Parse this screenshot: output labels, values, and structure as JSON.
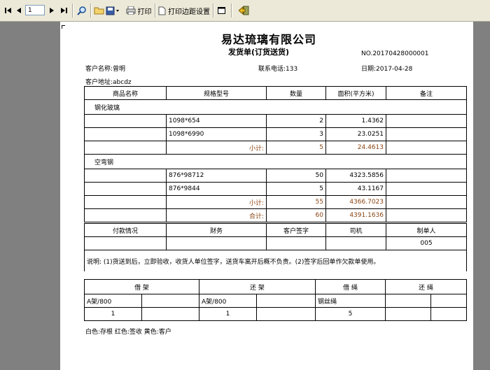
{
  "toolbar": {
    "page_number": "1",
    "print_label": "打印",
    "margin_label": "打印边距设置"
  },
  "doc": {
    "company": "易达琉璃有限公司",
    "title": "发货单(订货送货)",
    "number": "NO.20170428000001",
    "customer_name": "客户名称:曾明",
    "phone": "联系电话:133",
    "date": "日期:2017-04-28",
    "address": "客户地址:abcdz"
  },
  "table": {
    "headers": [
      "商品名称",
      "规格型号",
      "数量",
      "面积(平方米)",
      "备注"
    ],
    "groups": [
      {
        "name": "钢化玻璃",
        "rows": [
          {
            "spec": "1098*654",
            "qty": "2",
            "area": "1.4362"
          },
          {
            "spec": "1098*6990",
            "qty": "3",
            "area": "23.0251"
          }
        ],
        "subtotal_label": "小计:",
        "subtotal_qty": "5",
        "subtotal_area": "24.4613"
      },
      {
        "name": "空弯钢",
        "rows": [
          {
            "spec": "876*98712",
            "qty": "50",
            "area": "4323.5856"
          },
          {
            "spec": "876*9844",
            "qty": "5",
            "area": "43.1167"
          }
        ],
        "subtotal_label": "小计:",
        "subtotal_qty": "55",
        "subtotal_area": "4366.7023"
      }
    ],
    "total_label": "合计:",
    "total_qty": "60",
    "total_area": "4391.1636"
  },
  "sign": {
    "headers": [
      "付款情况",
      "财务",
      "客户签字",
      "司机",
      "制单人"
    ],
    "maker": "005"
  },
  "note": "说明: (1)货送到后，立即验收，收货人单位签字，送货车离开后概不负责。(2)签字后回单作欠款单使用。",
  "rack": {
    "headers": [
      "借 架",
      "还 架",
      "借 绳",
      "还 绳"
    ],
    "row1": [
      "A架/800",
      "A架/800",
      "钢丝绳"
    ],
    "row2": [
      "1",
      "1",
      "5"
    ]
  },
  "footer": "白色:存根  红色:签收  黄色:客户"
}
